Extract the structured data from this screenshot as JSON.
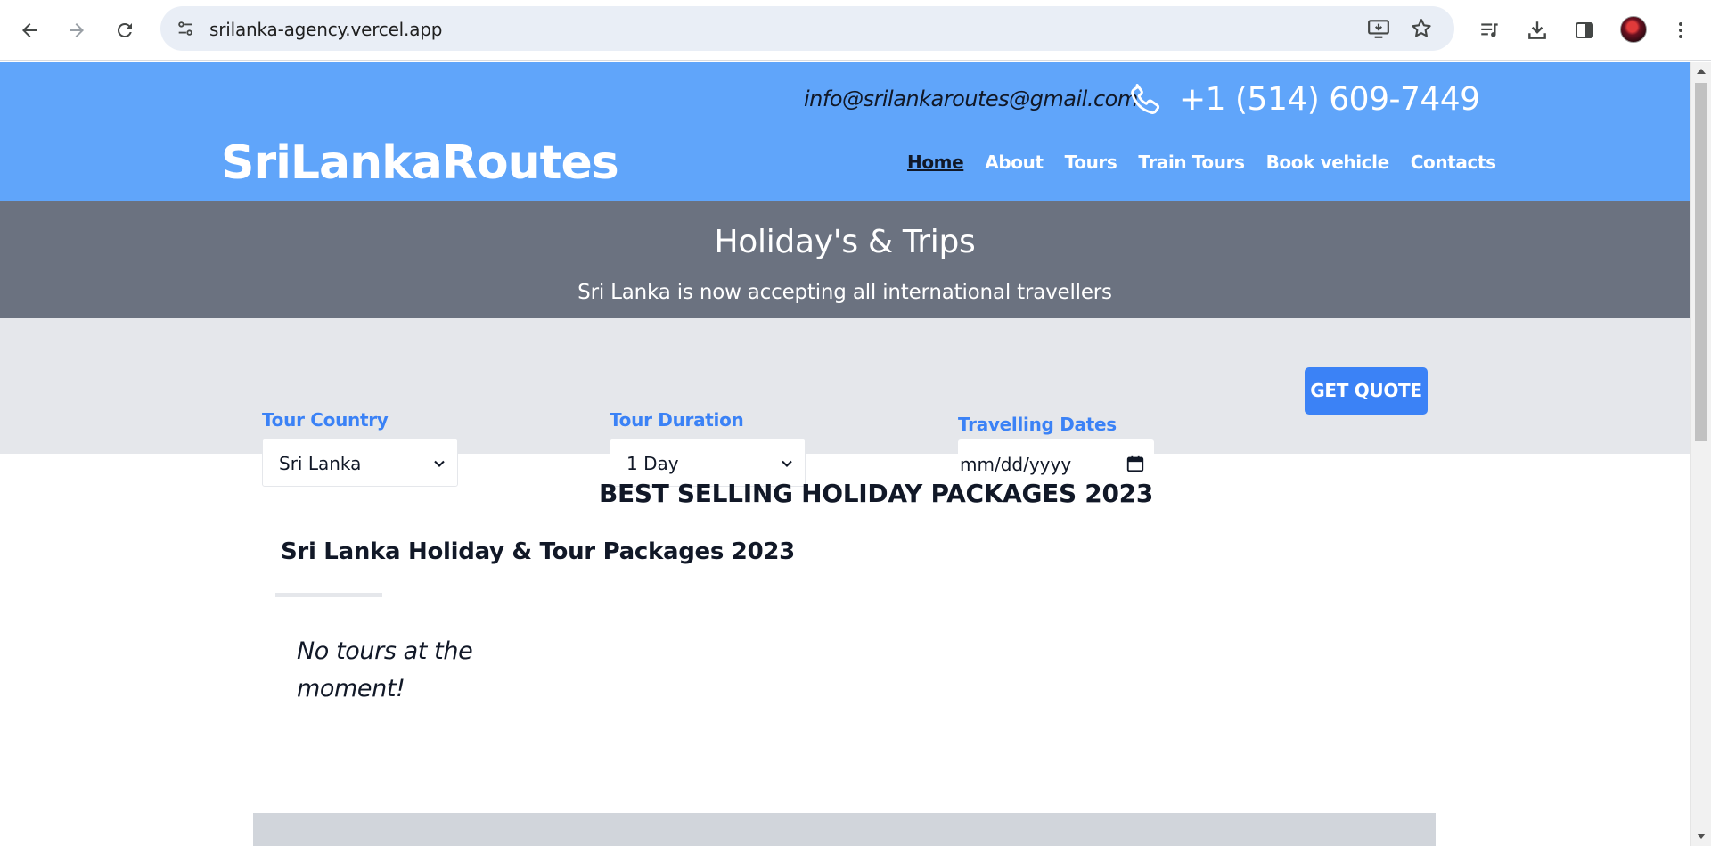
{
  "browser": {
    "url": "srilanka-agency.vercel.app",
    "icons": [
      "back-arrow-icon",
      "forward-arrow-icon",
      "reload-icon",
      "site-info-icon",
      "install-app-icon",
      "bookmark-star-icon",
      "media-queue-icon",
      "download-icon",
      "side-panel-icon",
      "profile-avatar",
      "kebab-menu-icon"
    ]
  },
  "header": {
    "email": "info@srilankaroutes@gmail.com",
    "phone": "+1 (514) 609-7449",
    "logo": "SriLankaRoutes",
    "nav": [
      {
        "label": "Home",
        "active": true
      },
      {
        "label": "About"
      },
      {
        "label": "Tours"
      },
      {
        "label": "Train Tours"
      },
      {
        "label": "Book vehicle"
      },
      {
        "label": "Contacts"
      }
    ]
  },
  "hero": {
    "title": "Holiday's & Trips",
    "subtitle": "Sri Lanka is now accepting all international travellers"
  },
  "search": {
    "country": {
      "label": "Tour Country",
      "value": "Sri Lanka"
    },
    "duration": {
      "label": "Tour Duration",
      "value": "1 Day"
    },
    "dates": {
      "label": "Travelling Dates",
      "placeholder": "mm/dd/yyyy"
    },
    "button": "GET QUOTE"
  },
  "content": {
    "section_title": "BEST SELLING HOLIDAY PACKAGES 2023",
    "sub_title": "Sri Lanka Holiday & Tour Packages 2023",
    "empty_message": "No tours at the moment!"
  },
  "colors": {
    "header_bg": "#60a5fa",
    "hero_bg": "#6b7280",
    "search_bg": "#e5e7eb",
    "accent": "#3b82f6"
  }
}
